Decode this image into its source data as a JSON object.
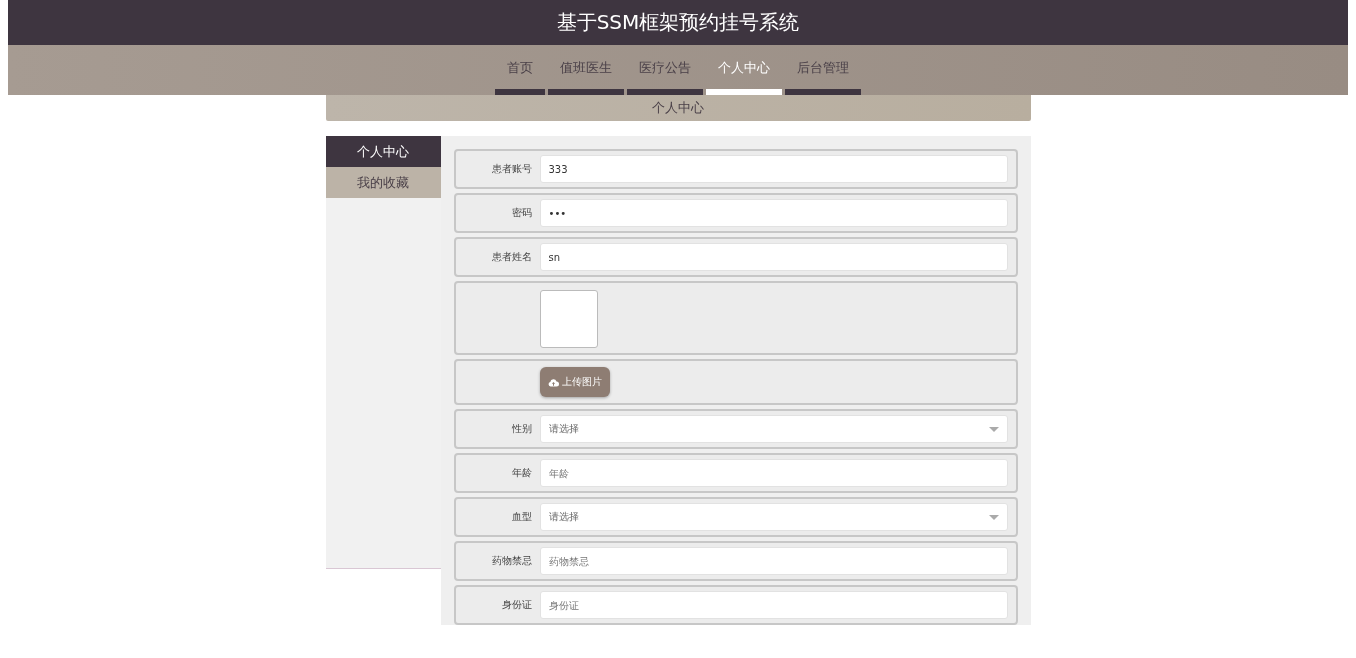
{
  "header": {
    "title": "基于SSM框架预约挂号系统"
  },
  "nav": [
    {
      "label": "首页",
      "selected": false
    },
    {
      "label": "值班医生",
      "selected": false
    },
    {
      "label": "医疗公告",
      "selected": false
    },
    {
      "label": "个人中心",
      "selected": true
    },
    {
      "label": "后台管理",
      "selected": false
    }
  ],
  "breadcrumb": "个人中心",
  "sidebar": {
    "items": [
      {
        "label": "个人中心",
        "selected": true
      },
      {
        "label": "我的收藏",
        "selected": false
      }
    ]
  },
  "form": {
    "fields": [
      {
        "kind": "text",
        "label": "患者账号",
        "value": "333"
      },
      {
        "kind": "text",
        "label": "密码",
        "value": "•••"
      },
      {
        "kind": "text",
        "label": "患者姓名",
        "value": "sn"
      },
      {
        "kind": "image"
      },
      {
        "kind": "upload",
        "button": "上传图片"
      },
      {
        "kind": "select",
        "label": "性别",
        "placeholder": "请选择"
      },
      {
        "kind": "text",
        "label": "年龄",
        "placeholder": "年龄"
      },
      {
        "kind": "select",
        "label": "血型",
        "placeholder": "请选择"
      },
      {
        "kind": "text",
        "label": "药物禁忌",
        "placeholder": "药物禁忌"
      },
      {
        "kind": "text",
        "label": "身份证",
        "placeholder": "身份证"
      }
    ]
  }
}
